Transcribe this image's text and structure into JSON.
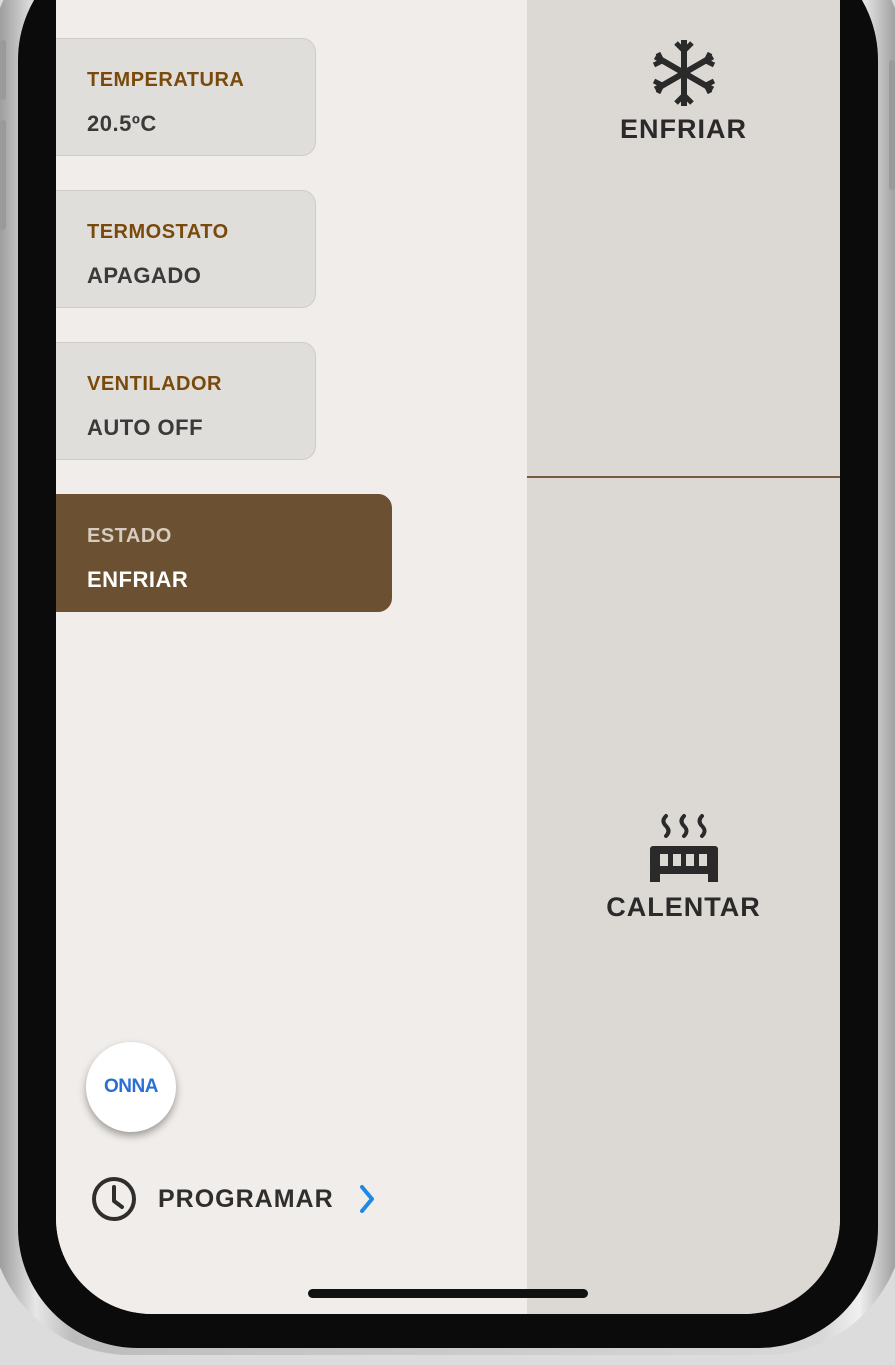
{
  "cards": [
    {
      "label": "TEMPERATURA",
      "value": "20.5ºC"
    },
    {
      "label": "TERMOSTATO",
      "value": "APAGADO"
    },
    {
      "label": "VENTILADOR",
      "value": "AUTO OFF"
    },
    {
      "label": "ESTADO",
      "value": "ENFRIAR"
    }
  ],
  "modes": {
    "cool": {
      "label": "ENFRIAR",
      "icon": "snowflake-icon"
    },
    "heat": {
      "label": "CALENTAR",
      "icon": "heater-icon"
    }
  },
  "logo": {
    "text": "ONNA"
  },
  "schedule": {
    "label": "PROGRAMAR",
    "icon": "clock-icon",
    "chevron_icon": "chevron-right-icon"
  },
  "colors": {
    "accent_brown": "#6b5032",
    "label_brown": "#7a4a0c",
    "chevron_blue": "#1e88e5",
    "logo_blue": "#2b6fd6"
  }
}
